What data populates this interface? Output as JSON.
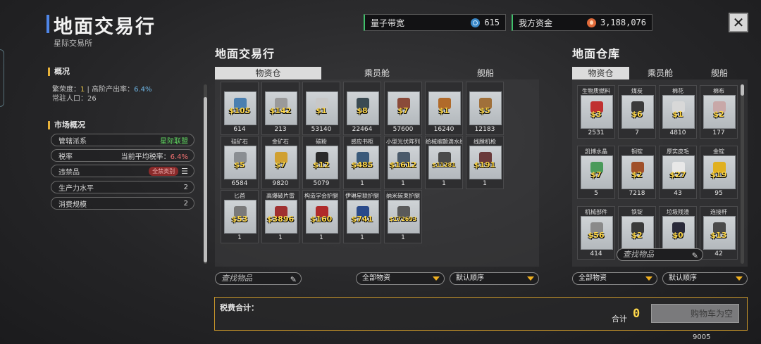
{
  "header": {
    "title": "地面交易行",
    "subtitle": "星际交易所"
  },
  "overview": {
    "heading": "概况",
    "line1_label": "繁荣度：",
    "prosperity": "1",
    "line1_sep": " | 高阶产出率：",
    "output_rate": "6.4%",
    "line2": "常驻人口：26"
  },
  "market": {
    "heading": "市场概况",
    "rows": [
      {
        "label": "管辖派系",
        "value": "星际联盟"
      },
      {
        "label": "税率",
        "value_prefix": "当前平均税率：",
        "value": "6.4%"
      },
      {
        "label": "违禁品",
        "value": "全禁类别",
        "icon": "menu-icon"
      },
      {
        "label": "生产力水平",
        "value": "2"
      },
      {
        "label": "消费规模",
        "value": "2"
      }
    ]
  },
  "topbar": {
    "bandwidth_label": "量子带宽",
    "bandwidth_value": "615",
    "funds_label": "我方资金",
    "funds_value": "3,188,076",
    "close_label": "✕"
  },
  "trade_panel": {
    "title": "地面交易行",
    "tabs": [
      "物资仓",
      "乘员舱",
      "舰船"
    ],
    "items": [
      {
        "name": "",
        "price": "$105",
        "qty": "614",
        "color": "#4a7fb0"
      },
      {
        "name": "",
        "price": "$142",
        "qty": "213",
        "color": "#9a9a9a"
      },
      {
        "name": "",
        "price": "$1",
        "qty": "53140",
        "color": "#c8c8c8"
      },
      {
        "name": "",
        "price": "$8",
        "qty": "22464",
        "color": "#3a4a52"
      },
      {
        "name": "",
        "price": "$7",
        "qty": "57600",
        "color": "#8a4a3a"
      },
      {
        "name": "",
        "price": "$1",
        "qty": "16240",
        "color": "#b06a2a"
      },
      {
        "name": "",
        "price": "$5",
        "qty": "12183",
        "color": "#a0703a"
      },
      {
        "name": "硅矿石",
        "price": "$5",
        "qty": "6584",
        "color": "#8a8e92"
      },
      {
        "name": "金矿石",
        "price": "$7",
        "qty": "9820",
        "color": "#d0a030"
      },
      {
        "name": "碳粉",
        "price": "$12",
        "qty": "5079",
        "color": "#2a2a2a"
      },
      {
        "name": "感应书柜",
        "price": "$485",
        "qty": "1",
        "color": "#3a5a7a"
      },
      {
        "name": "小型光伏阵列",
        "price": "$1612",
        "qty": "1",
        "color": "#4a5a6a"
      },
      {
        "name": "给械缩颤滴水线",
        "price": "$11281",
        "qty": "1",
        "color": "#4a4a4a",
        "small": true
      },
      {
        "name": "线膛机枪",
        "price": "$191",
        "qty": "1",
        "color": "#6a3a3a"
      },
      {
        "name": "匕首",
        "price": "$53",
        "qty": "1",
        "color": "#7a7a7a"
      },
      {
        "name": "高爆破片雷",
        "price": "$3896",
        "qty": "1",
        "color": "#a03030"
      },
      {
        "name": "构造学会护腿",
        "price": "$160",
        "qty": "1",
        "color": "#b02a2a"
      },
      {
        "name": "伊琳星联护腿",
        "price": "$741",
        "qty": "1",
        "color": "#2a4a8a"
      },
      {
        "name": "纳米碳束护腿",
        "price": "$172693",
        "qty": "1",
        "color": "#5a5a5a",
        "small": true
      }
    ],
    "search_placeholder": "查找物品",
    "filter": "全部物资",
    "sort": "默认顺序"
  },
  "warehouse_panel": {
    "title": "地面仓库",
    "tabs": [
      "物资仓",
      "乘员舱",
      "舰船"
    ],
    "items": [
      {
        "name": "生物质燃料",
        "price": "$3",
        "qty": "2531",
        "color": "#c03030"
      },
      {
        "name": "煤炭",
        "price": "$6",
        "qty": "7",
        "color": "#3a3a3a"
      },
      {
        "name": "棉花",
        "price": "$1",
        "qty": "4810",
        "color": "#d8d8d8"
      },
      {
        "name": "棉布",
        "price": "$2",
        "qty": "177",
        "color": "#c8a8a8"
      },
      {
        "name": "凯博水晶",
        "price": "$7",
        "qty": "5",
        "color": "#4a9a5a"
      },
      {
        "name": "铜锭",
        "price": "$2",
        "qty": "7218",
        "color": "#a0502a"
      },
      {
        "name": "厚实皮毛",
        "price": "$27",
        "qty": "43",
        "color": "#e8e8e8"
      },
      {
        "name": "金锭",
        "price": "$19",
        "qty": "95",
        "color": "#e0b020"
      },
      {
        "name": "机械部件",
        "price": "$56",
        "qty": "414",
        "color": "#8a8a8a"
      },
      {
        "name": "铁锭",
        "price": "$2",
        "qty": "",
        "color": "#3a3a3a"
      },
      {
        "name": "垃圾残渣",
        "price": "$0",
        "qty": "",
        "color": "#2a2a3a"
      },
      {
        "name": "连接杆",
        "price": "$13",
        "qty": "42",
        "color": "#4a4a4a"
      }
    ],
    "search_placeholder": "查找物品",
    "filter": "全部物资",
    "sort": "默认顺序"
  },
  "footer": {
    "tax_label": "税费合计：",
    "total_label": "合计",
    "total_value": "0",
    "cart_button": "购物车为空",
    "number": "9005"
  }
}
